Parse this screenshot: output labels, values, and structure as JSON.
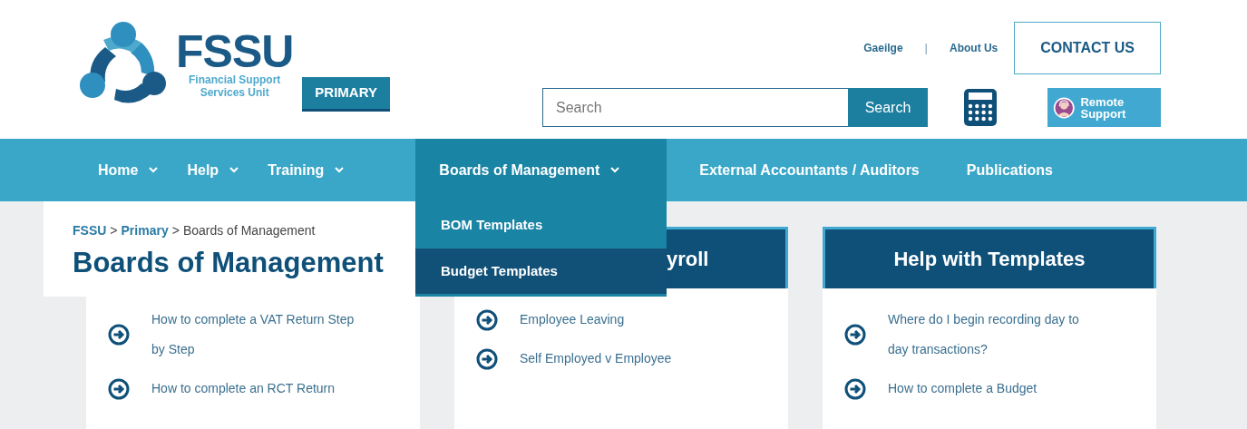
{
  "header": {
    "logo": {
      "title": "FSSU",
      "subtitle": "Financial Support Services Unit"
    },
    "badge": "PRIMARY",
    "top_links": [
      {
        "label": "Gaeilge"
      },
      {
        "label": "About Us"
      }
    ],
    "top_link_separator": "|",
    "contact_button": "CONTACT US",
    "search": {
      "placeholder": "Search",
      "button": "Search"
    },
    "remote_support": "Remote Support"
  },
  "nav": {
    "items": [
      {
        "label": "Home",
        "has_dropdown": true,
        "selected": false
      },
      {
        "label": "Help",
        "has_dropdown": true,
        "selected": false
      },
      {
        "label": "Training",
        "has_dropdown": true,
        "selected": false
      },
      {
        "label": "Boards of Management",
        "has_dropdown": true,
        "selected": true
      },
      {
        "label": "External Accountants / Auditors",
        "has_dropdown": false,
        "selected": false
      },
      {
        "label": "Publications",
        "has_dropdown": false,
        "selected": false
      }
    ]
  },
  "dropdown": {
    "items": [
      {
        "label": "BOM Templates",
        "selected": false
      },
      {
        "label": "Budget Templates",
        "selected": true
      }
    ]
  },
  "breadcrumb": {
    "items": [
      {
        "label": "FSSU",
        "kind": "link"
      },
      {
        "label": "Primary",
        "kind": "link"
      },
      {
        "label": "Boards of Management",
        "kind": "current"
      }
    ],
    "separator": ">"
  },
  "page_title": "Boards of Management",
  "cards": [
    {
      "links": [
        "How to complete a VAT Return Step by Step",
        "How to complete an RCT Return"
      ]
    },
    {
      "title": "yroll",
      "links": [
        "Employee Leaving",
        "Self Employed v Employee"
      ]
    },
    {
      "title": "Help with Templates",
      "links": [
        "Where do I begin recording day to day transactions?",
        "How to complete a Budget"
      ]
    }
  ]
}
